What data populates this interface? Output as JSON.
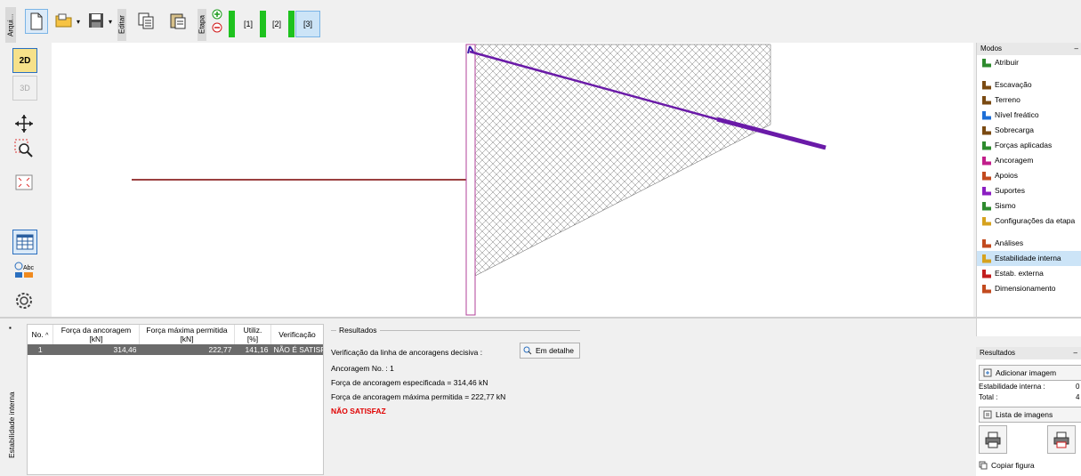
{
  "toolbar": {
    "arquivo_label": "Arqui...",
    "editar_label": "Editar",
    "etapa_label": "Etapa",
    "stages": [
      "[1]",
      "[2]",
      "[3]"
    ]
  },
  "left_tools": {
    "btn_2d": "2D",
    "btn_3d": "3D"
  },
  "modes": {
    "title": "Modos",
    "items": [
      {
        "label": "Atribuir",
        "icon": "assign-icon",
        "color": "#2e8b2e"
      },
      {
        "label": "Escavação",
        "icon": "excavation-icon",
        "color": "#7a4a12"
      },
      {
        "label": "Terreno",
        "icon": "terrain-icon",
        "color": "#7a4a12"
      },
      {
        "label": "Nível freático",
        "icon": "water-level-icon",
        "color": "#1e6fd6"
      },
      {
        "label": "Sobrecarga",
        "icon": "surcharge-icon",
        "color": "#7a4a12"
      },
      {
        "label": "Forças aplicadas",
        "icon": "applied-forces-icon",
        "color": "#2e8b2e"
      },
      {
        "label": "Ancoragem",
        "icon": "anchor-icon",
        "color": "#c21e8b"
      },
      {
        "label": "Apoios",
        "icon": "props-icon",
        "color": "#c24a1e"
      },
      {
        "label": "Suportes",
        "icon": "supports-icon",
        "color": "#8b1ec2"
      },
      {
        "label": "Sismo",
        "icon": "earthquake-icon",
        "color": "#2e8b2e"
      },
      {
        "label": "Configurações da etapa",
        "icon": "stage-settings-icon",
        "color": "#d6a21e"
      },
      {
        "label": "Análises",
        "icon": "analysis-icon",
        "color": "#c24a1e"
      },
      {
        "label": "Estabilidade interna",
        "icon": "internal-stability-icon",
        "color": "#d6a21e"
      },
      {
        "label": "Estab. externa",
        "icon": "external-stability-icon",
        "color": "#c21e1e"
      },
      {
        "label": "Dimensionamento",
        "icon": "dimensioning-icon",
        "color": "#c24a1e"
      }
    ]
  },
  "table": {
    "headers": [
      {
        "line1": "No.",
        "line2": ""
      },
      {
        "line1": "Força da ancoragem",
        "line2": "[kN]"
      },
      {
        "line1": "Força máxima permitida",
        "line2": "[kN]"
      },
      {
        "line1": "Utiliz.",
        "line2": "[%]"
      },
      {
        "line1": "Verificação",
        "line2": ""
      }
    ],
    "rows": [
      {
        "no": "1",
        "force": "314,46",
        "max_force": "222,77",
        "util": "141,16",
        "check": "NÃO É SATISF"
      }
    ]
  },
  "side_tab": "Estabilidade interna",
  "results": {
    "title": "Resultados",
    "verification_label": "Verificação da linha de ancoragens decisiva :",
    "detail_button": "Em detalhe",
    "anchor_no": "Ancoragem No. : 1",
    "specified_force": "Força de ancoragem especificada = 314,46 kN",
    "max_force": "Força de ancoragem máxima permitida = 222,77 kN",
    "status": "NÃO SATISFAZ",
    "status_color": "#e00000"
  },
  "results_panel": {
    "title": "Resultados",
    "add_image": "Adicionar imagem",
    "internal_label": "Estabilidade interna :",
    "internal_value": "0",
    "total_label": "Total :",
    "total_value": "4",
    "image_list": "Lista de imagens",
    "copy_figure": "Copiar figura"
  }
}
